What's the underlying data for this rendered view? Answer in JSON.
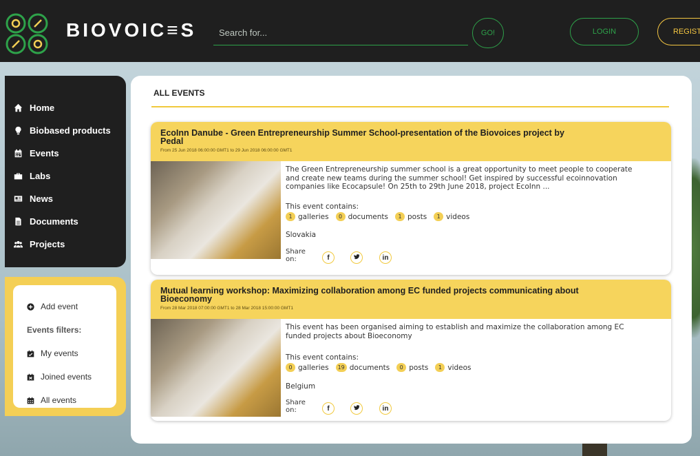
{
  "brand": {
    "name": "BIOVOIC≡S"
  },
  "header": {
    "search_placeholder": "Search for...",
    "go_label": "GO!",
    "login_label": "LOGIN",
    "register_label": "REGISTER"
  },
  "colors": {
    "accent_green": "#2ea24a",
    "accent_yellow": "#f4cf55",
    "dark": "#1f1f1f"
  },
  "nav": {
    "items": [
      {
        "label": "Home",
        "icon": "home-icon"
      },
      {
        "label": "Biobased products",
        "icon": "lightbulb-icon"
      },
      {
        "label": "Events",
        "icon": "calendar-icon"
      },
      {
        "label": "Labs",
        "icon": "briefcase-icon"
      },
      {
        "label": "News",
        "icon": "newspaper-icon"
      },
      {
        "label": "Documents",
        "icon": "file-icon"
      },
      {
        "label": "Projects",
        "icon": "users-icon"
      }
    ]
  },
  "filters": {
    "add_event": "Add event",
    "heading": "Events filters:",
    "my_events": "My events",
    "joined_events": "Joined events",
    "all_events": "All events"
  },
  "main": {
    "title": "ALL EVENTS",
    "contains_label": "This event contains:",
    "share_label": "Share on:",
    "events": [
      {
        "title": "EcoInn Danube - Green Entrepreneurship Summer School-presentation of the Biovoices project by Pedal",
        "date": "From 25 Jun 2018 06:00:00 GMT1 to 29 Jun 2018 06:00:00 GMT1",
        "description": "The Green Entrepreneurship summer school is a great opportunity to meet people to cooperate and create new teams during the summer school! Get inspired by successful ecoinnovation companies like Ecocapsule! On 25th to 29th June 2018, project EcoInn ...",
        "galleries": "1",
        "documents": "0",
        "posts": "1",
        "videos": "1",
        "country": "Slovakia"
      },
      {
        "title": "Mutual learning workshop: Maximizing collaboration among EC funded projects communicating about Bioeconomy",
        "date": "From 28 Mar 2018 07:00:00 GMT1 to 28 Mar 2018 15:00:00 GMT1",
        "description": "This event has been organised aiming to establish and maximize the collaboration among EC funded projects about Bioeconomy",
        "galleries": "0",
        "documents": "19",
        "posts": "0",
        "videos": "1",
        "country": "Belgium"
      }
    ],
    "count_labels": {
      "galleries": "galleries",
      "documents": "documents",
      "posts": "posts",
      "videos": "videos"
    }
  }
}
